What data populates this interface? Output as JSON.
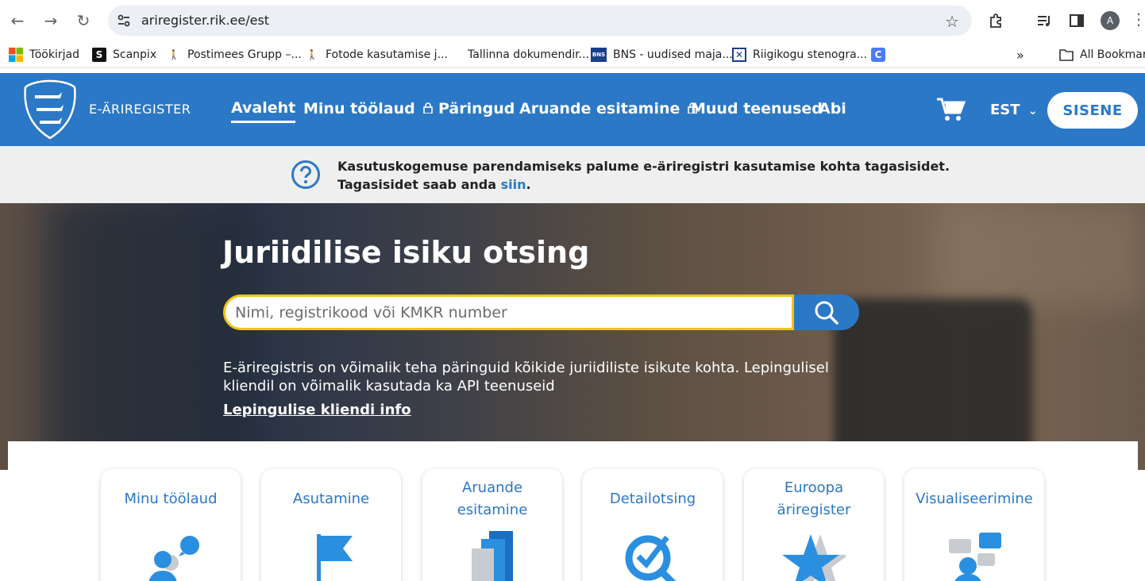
{
  "browser": {
    "url": "ariregister.rik.ee/est",
    "avatar_letter": "A",
    "bookmarks": [
      {
        "label": "Töökirjad",
        "icon": "windows-icon"
      },
      {
        "label": "Scanpix",
        "icon": "scanpix-icon"
      },
      {
        "label": "Postimees Grupp –...",
        "icon": "walker-icon"
      },
      {
        "label": "Fotode kasutamise j...",
        "icon": "walker-icon"
      },
      {
        "label": "Tallinna dokumendir...",
        "icon": "blank"
      },
      {
        "label": "BNS - uudised maja...",
        "icon": "bns-icon"
      },
      {
        "label": "Riigikogu stenogra...",
        "icon": "riigikogu-icon"
      },
      {
        "label": "",
        "icon": "c-icon"
      }
    ],
    "more_bookmarks": "»",
    "all_bookmarks": "All Bookmark"
  },
  "header": {
    "logo_text": "E-ÄRIREGISTER",
    "nav": [
      {
        "label": "Avaleht",
        "active": true,
        "locked": false
      },
      {
        "label": "Minu töölaud",
        "active": false,
        "locked": true
      },
      {
        "label": "Päringud",
        "active": false,
        "locked": false
      },
      {
        "label": "Aruande esitamine",
        "active": false,
        "locked": true
      },
      {
        "label": "Muud teenused",
        "active": false,
        "locked": false
      },
      {
        "label": "Abi",
        "active": false,
        "locked": false
      }
    ],
    "language": "EST",
    "signin_label": "SISENE"
  },
  "feedback": {
    "line1": "Kasutuskogemuse parendamiseks palume e-äriregistri kasutamise kohta tagasisidet.",
    "line2_prefix": "Tagasisidet saab anda ",
    "line2_link": "siin",
    "line2_suffix": "."
  },
  "hero": {
    "title": "Juriidilise isiku otsing",
    "search_placeholder": "Nimi, registrikood või KMKR number",
    "description": "E-äriregistris on võimalik teha päringuid kõikide juriidiliste isikute kohta. Lepingulisel kliendil on võimalik kasutada ka API teenuseid",
    "link_label": "Lepingulise kliendi info"
  },
  "cards": [
    {
      "line1": "Minu töölaud",
      "line2": ""
    },
    {
      "line1": "Asutamine",
      "line2": ""
    },
    {
      "line1": "Aruande",
      "line2": "esitamine"
    },
    {
      "line1": "Detailotsing",
      "line2": ""
    },
    {
      "line1": "Euroopa",
      "line2": "äriregister"
    },
    {
      "line1": "Visualiseerimine",
      "line2": ""
    }
  ],
  "colors": {
    "brand_blue": "#2b78c6",
    "search_border": "#f0c419",
    "feedback_bg": "#efefef"
  }
}
